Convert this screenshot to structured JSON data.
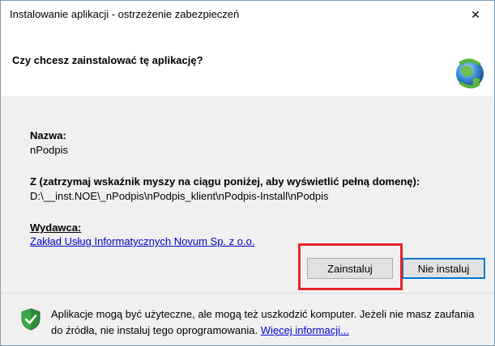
{
  "window": {
    "title": "Instalowanie aplikacji - ostrzeżenie zabezpieczeń",
    "close_glyph": "✕"
  },
  "header": {
    "question": "Czy chcesz zainstalować tę aplikację?",
    "app_icon": "globe-install-icon"
  },
  "details": {
    "name_label": "Nazwa:",
    "name_value": "nPodpis",
    "from_label": "Z (zatrzymaj wskaźnik myszy na ciągu poniżej, aby wyświetlić pełną domenę):",
    "from_value": "D:\\__inst.NOE\\_nPodpis\\nPodpis_klient\\nPodpis-Install\\nPodpis",
    "publisher_label": "Wydawca:",
    "publisher_value": "Zakład Usług Informatycznych Novum Sp. z o.o."
  },
  "buttons": {
    "install": "Zainstaluj",
    "dont_install": "Nie instaluj"
  },
  "footer": {
    "warning_text": "Aplikacje mogą być użyteczne, ale mogą też uszkodzić komputer. Jeżeli nie masz zaufania do źródła, nie instaluj tego oprogramowania.",
    "more_info_link": "Więcej informacji...",
    "icon": "shield-check-icon"
  },
  "colors": {
    "highlight": "#e3242b",
    "link": "#0000cc",
    "default_button_border": "#0078d7"
  }
}
